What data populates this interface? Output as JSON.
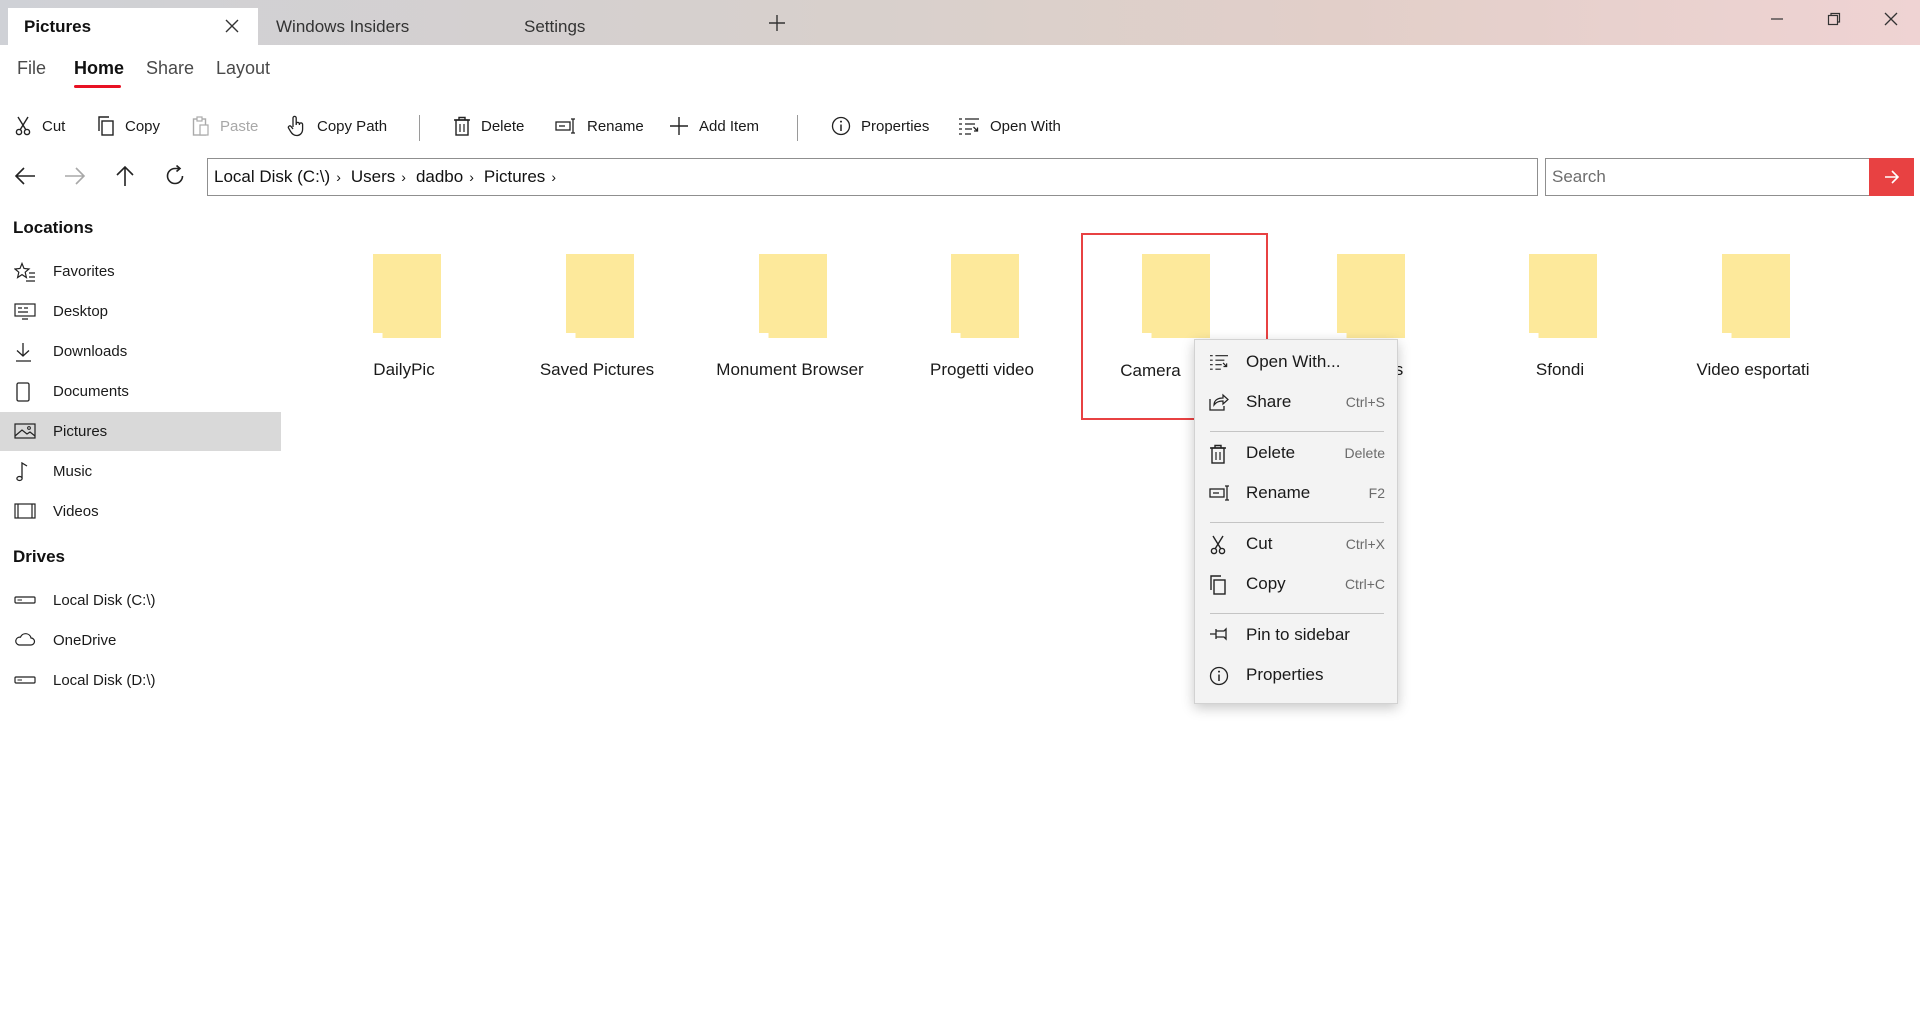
{
  "tabs": [
    {
      "label": "Pictures",
      "active": true
    },
    {
      "label": "Windows Insiders",
      "active": false
    },
    {
      "label": "Settings",
      "active": false
    }
  ],
  "ribbon": {
    "tabs": [
      "File",
      "Home",
      "Share",
      "Layout"
    ],
    "active": "Home"
  },
  "toolbar": {
    "cut": "Cut",
    "copy": "Copy",
    "paste": "Paste",
    "copy_path": "Copy Path",
    "delete": "Delete",
    "rename": "Rename",
    "add_item": "Add Item",
    "properties": "Properties",
    "open_with": "Open With"
  },
  "address": {
    "crumbs": [
      "Local Disk (C:\\)",
      "Users",
      "dadbo",
      "Pictures"
    ],
    "separator": "›"
  },
  "search": {
    "placeholder": "Search"
  },
  "sidebar": {
    "locations_header": "Locations",
    "locations": [
      "Favorites",
      "Desktop",
      "Downloads",
      "Documents",
      "Pictures",
      "Music",
      "Videos"
    ],
    "selected": "Pictures",
    "drives_header": "Drives",
    "drives": [
      "Local Disk (C:\\)",
      "OneDrive",
      "Local Disk (D:\\)"
    ]
  },
  "folders": [
    "DailyPic",
    "Saved Pictures",
    "Monument Browser",
    "Progetti video",
    "Camera",
    "ts",
    "Sfondi",
    "Video esportati"
  ],
  "selected_folder": "Camera",
  "context_menu": {
    "open_with": "Open With...",
    "share": "Share",
    "share_kb": "Ctrl+S",
    "delete": "Delete",
    "delete_kb": "Delete",
    "rename": "Rename",
    "rename_kb": "F2",
    "cut": "Cut",
    "cut_kb": "Ctrl+X",
    "copy": "Copy",
    "copy_kb": "Ctrl+C",
    "pin": "Pin to sidebar",
    "properties": "Properties"
  },
  "colors": {
    "accent": "#e84142",
    "folder": "#fde99b",
    "selected_nav": "#d9d9d9"
  }
}
